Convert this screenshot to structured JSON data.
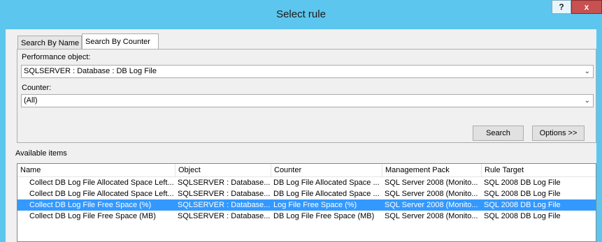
{
  "window": {
    "title": "Select rule",
    "help_label": "?",
    "close_label": "x"
  },
  "tabs": [
    {
      "label": "Search By Name"
    },
    {
      "label": "Search By Counter"
    }
  ],
  "performance_object": {
    "label": "Performance object:",
    "value": "SQLSERVER : Database : DB Log File"
  },
  "counter": {
    "label": "Counter:",
    "value": "(All)"
  },
  "buttons": {
    "search": "Search",
    "options": "Options >>"
  },
  "available": {
    "label": "Available items",
    "columns": [
      "Name",
      "Object",
      "Counter",
      "Management Pack",
      "Rule Target"
    ],
    "rows": [
      [
        "Collect DB Log File Allocated Space Left...",
        "SQLSERVER : Database...",
        "DB Log File Allocated Space ...",
        "SQL Server 2008 (Monito...",
        "SQL 2008 DB Log File"
      ],
      [
        "Collect DB Log File Allocated Space Left...",
        "SQLSERVER : Database...",
        "DB Log File Allocated Space ...",
        "SQL Server 2008 (Monito...",
        "SQL 2008 DB Log File"
      ],
      [
        "Collect DB Log File Free Space (%)",
        "SQLSERVER : Database...",
        "Log File Free Space (%)",
        "SQL Server 2008 (Monito...",
        "SQL 2008 DB Log File"
      ],
      [
        "Collect DB Log File Free Space (MB)",
        "SQLSERVER : Database...",
        "DB Log File Free Space (MB)",
        "SQL Server 2008 (Monito...",
        "SQL 2008 DB Log File"
      ]
    ],
    "selected_row": 2
  },
  "colors": {
    "titlebar": "#5cc6ee",
    "selection": "#3399ff",
    "close": "#c75050"
  }
}
